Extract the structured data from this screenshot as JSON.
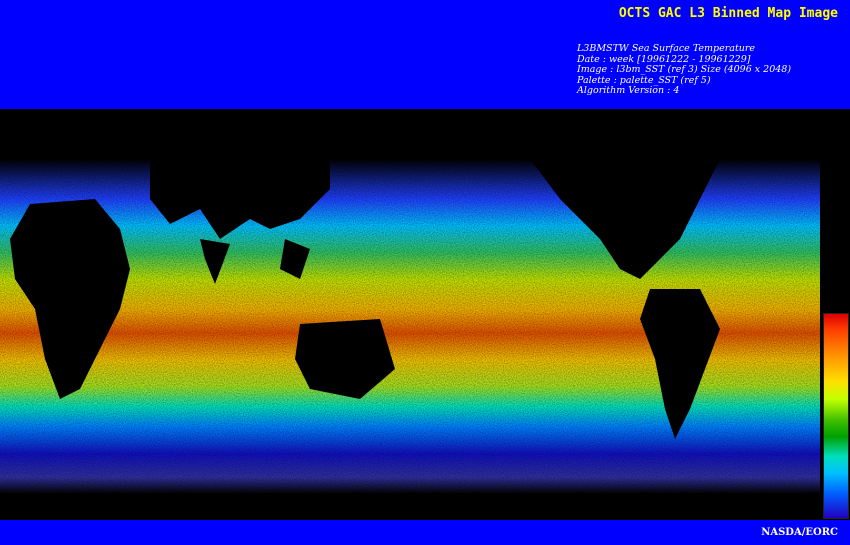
{
  "header": {
    "title": "OCTS GAC L3 Binned Map Image",
    "meta_lines": [
      "L3BMSTW Sea Surface Temperature",
      "Date : week [19961222 - 19961229]",
      "Image : l3bm_SST (ref 3) Size (4096 x 2048)",
      "Palette : palette_SST (ref 5)",
      "Algorithm Version : 4"
    ]
  },
  "footer": {
    "label": "NASDA/EORC"
  },
  "colors": {
    "header_bg": "#0000ff",
    "title_text": "#ffff00",
    "land": "#000000"
  },
  "colorbar": {
    "stops": [
      "#e00000",
      "#ff9000",
      "#ffe000",
      "#40c000",
      "#00e0c0",
      "#0060ff",
      "#2000c0"
    ]
  }
}
